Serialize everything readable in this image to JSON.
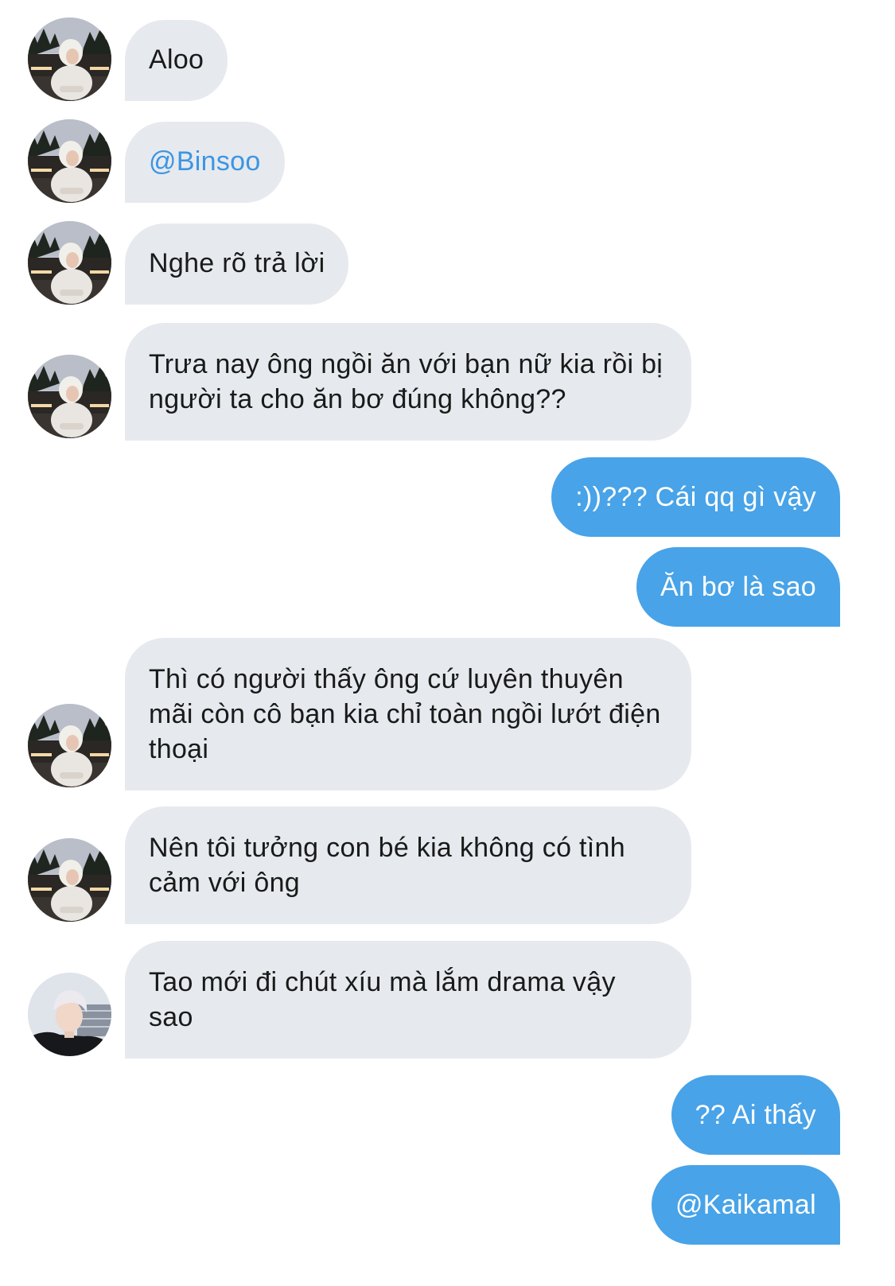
{
  "messages": [
    {
      "text": "Aloo",
      "avatar": "girl-avatar"
    },
    {
      "text": "@Binsoo",
      "avatar": "girl-avatar"
    },
    {
      "text": "Nghe rõ trả lời",
      "avatar": "girl-avatar"
    },
    {
      "text": "Trưa nay ông ngồi ăn với bạn nữ kia rồi bị người ta cho ăn bơ đúng không??",
      "avatar": "girl-avatar"
    },
    {
      "text": ":))??? Cái qq gì vậy"
    },
    {
      "text": "Ăn bơ là sao"
    },
    {
      "text": "Thì có người thấy ông cứ luyên thuyên mãi còn cô bạn kia chỉ toàn ngồi lướt điện thoại",
      "avatar": "girl-avatar"
    },
    {
      "text": "Nên tôi tưởng con bé kia không có tình cảm với ông",
      "avatar": "girl-avatar"
    },
    {
      "text": "Tao mới đi chút xíu mà lắm drama vậy sao",
      "avatar": "boy-avatar"
    },
    {
      "text": "?? Ai thấy"
    },
    {
      "text": "@Kaikamal"
    }
  ],
  "colors": {
    "incoming_bubble": "#e6eaee",
    "outgoing_bubble": "#48a3e8",
    "mention": "#3d95e3"
  }
}
